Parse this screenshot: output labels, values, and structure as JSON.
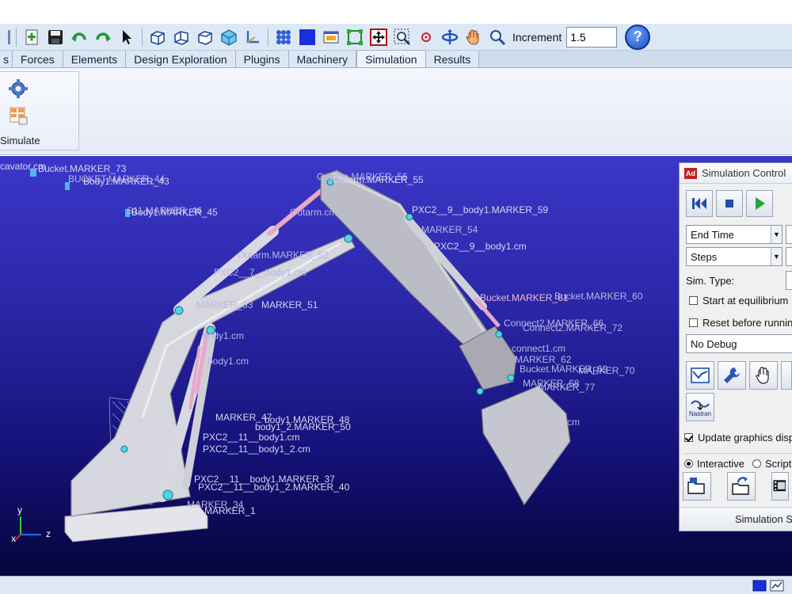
{
  "toolbar": {
    "icons": [
      "new-model-icon",
      "save-icon",
      "undo-icon",
      "redo-icon",
      "select-arrow-icon",
      "view-front-icon",
      "view-side-icon",
      "view-iso-icon",
      "view-3d-icon",
      "axes-icon",
      "mesh-icon",
      "render-icon",
      "view-fit-icon",
      "zoom-region-icon",
      "move-icon",
      "zoom-box-icon",
      "center-icon",
      "rotate-icon",
      "pan-hand-icon",
      "zoom-icon"
    ],
    "increment_label": "Increment",
    "increment_value": "1.5",
    "help_label": "?"
  },
  "tabs": [
    {
      "label": "s",
      "active": false
    },
    {
      "label": "Forces",
      "active": false
    },
    {
      "label": "Elements",
      "active": false
    },
    {
      "label": "Design Exploration",
      "active": false
    },
    {
      "label": "Plugins",
      "active": false
    },
    {
      "label": "Machinery",
      "active": false
    },
    {
      "label": "Simulation",
      "active": true
    },
    {
      "label": "Results",
      "active": false
    }
  ],
  "ribbon": {
    "group_label": "Simulate"
  },
  "viewport": {
    "labels": [
      "cavator.cm",
      "Bucket.MARKER_73",
      "BUCKET.MARKER_44",
      "Body1.MARKER_43",
      "S11.MARKER_46",
      "Body1.MARKER_45",
      "Outarm.cm",
      "Outarm.MARKER_56",
      "Outarm.MARKER_55",
      "PXC2__9__body1.MARKER_59",
      "MARKER_54",
      "PXC2__9__body1.cm",
      "Outarm.MARKER_52",
      "PXC2__7__body1.cm",
      "MARKER_51",
      "MARKER_53",
      "Bucket.MARKER_61",
      "Bucket.MARKER_60",
      "Connect2.MARKER_66",
      "Connect2.MARKER_72",
      "connect1.cm",
      "MARKER_62",
      "Bucket.MARKER_69",
      "MARKER_70",
      "MARKER_68",
      "MARKER_77",
      "body1.cm",
      "body1.cm",
      "MARKER_47",
      "body1.MARKER_48",
      "body1_2.MARKER_50",
      "PXC2__11__body1.cm",
      "PXC2__11__body1_2.cm",
      "PXC2__11__body1.MARKER_37",
      "PXC2__11__body1_2.MARKER_40",
      "MARKER_1",
      "cm",
      "MARKER_34"
    ],
    "axis_y": "y",
    "axis_z": "z",
    "axis_x": "x"
  },
  "sim_control": {
    "badge": "Ad",
    "title": "Simulation Control",
    "end_time_label": "End Time",
    "steps_label": "Steps",
    "sim_type_label": "Sim. Type:",
    "start_equilibrium_label": "Start at equilibrium",
    "reset_before_label": "Reset before running",
    "debug_value": "No Debug",
    "nastran_label": "Nastran",
    "update_graphics_label": "Update graphics display",
    "interactive_label": "Interactive",
    "scripted_label": "Scripted",
    "footer_label": "Simulation Settings"
  }
}
